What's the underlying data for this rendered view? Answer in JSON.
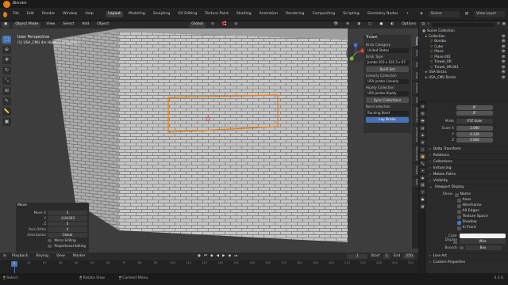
{
  "app": {
    "title": "Blender",
    "menus": [
      "File",
      "Edit",
      "Render",
      "Window",
      "Help"
    ]
  },
  "workspaces": [
    "Layout",
    "Modeling",
    "Sculpting",
    "UV Editing",
    "Texture Paint",
    "Shading",
    "Animation",
    "Rendering",
    "Compositing",
    "Scripting",
    "Geometry Nodes"
  ],
  "active_workspace": "Layout",
  "scene": {
    "scene_label": "Scene",
    "layer_label": "View Layer"
  },
  "viewport_header": {
    "mode": "Object Mode",
    "menus": [
      "View",
      "Select",
      "Add",
      "Object"
    ],
    "transform": "Global",
    "options": "Options"
  },
  "viewport": {
    "view_name": "User Perspective",
    "object_label": "(1) USA_CMU 4in Hipety | Scapreset"
  },
  "tools": [
    "select-tool",
    "cursor-tool",
    "move-tool",
    "rotate-tool",
    "scale-tool",
    "transform-tool",
    "annotate-tool",
    "measure-tool",
    "add-cube-tool"
  ],
  "npanel": {
    "title": "Trowel",
    "brick_category_label": "Brick Category",
    "brick_category": "United States",
    "brick_type_label": "Brick Type",
    "brick_type": "Jumbo 203 x 101.5 x 67",
    "build_btn": "Build Set",
    "lineardy_label": "Linearly Collection",
    "lineardy": "USA Jumbo Linearly",
    "hipety_label": "Hipety Collection",
    "hipety": "USA Jumbo Hipety",
    "sync_btn": "Sync Collections",
    "bond_label": "Bond selection",
    "bond": "Running Bond",
    "lay_btn": "Lay Bricks"
  },
  "vtabs": [
    "Trowel",
    "Item",
    "Tool",
    "View",
    "Create",
    "Edit",
    "BlenderKit",
    "Animation",
    "Sketchfab",
    "Trowel",
    "CAD"
  ],
  "redo_panel": {
    "title": "Move",
    "rows": [
      {
        "label": "Move X",
        "value": "0"
      },
      {
        "label": "Y",
        "value": "-0.84393"
      },
      {
        "label": "Z",
        "value": "0"
      },
      {
        "label": "Axis Ortho",
        "value": "X"
      },
      {
        "label": "Orientation",
        "value": "Global"
      }
    ],
    "checks": [
      "Mirror Editing",
      "Proportional Editing"
    ]
  },
  "outliner": {
    "header": "Scene Collection",
    "rows": [
      {
        "name": "Collection",
        "indent": 0
      },
      {
        "name": "Bombo",
        "indent": 1
      },
      {
        "name": "Cube",
        "indent": 1
      },
      {
        "name": "Plane",
        "indent": 1
      },
      {
        "name": "Plane.001",
        "indent": 1
      },
      {
        "name": "Trowel_OR",
        "indent": 1
      },
      {
        "name": "Trowel_OR.001",
        "indent": 1
      },
      {
        "name": "USA Bricks",
        "indent": 0
      },
      {
        "name": "USA_CMU Bricks",
        "indent": 0
      }
    ]
  },
  "properties": {
    "rot_rows": [
      {
        "label": "",
        "value": "0°"
      },
      {
        "label": "",
        "value": "0°"
      },
      {
        "label": "Mode",
        "value": "XYZ Euler"
      }
    ],
    "scale_rows": [
      {
        "label": "Scale X",
        "value": "2.000"
      },
      {
        "label": "Y",
        "value": "0.128"
      },
      {
        "label": "Z",
        "value": "2.000"
      }
    ],
    "sections": [
      "Delta Transform",
      "Relations",
      "Collections",
      "Instancing",
      "Motion Paths",
      "Visibility",
      "Viewport Display"
    ],
    "vd_show_label": "Show",
    "vd_checks": [
      {
        "label": "Name",
        "on": false
      },
      {
        "label": "Axes",
        "on": false
      },
      {
        "label": "Wireframe",
        "on": false
      },
      {
        "label": "All Edges",
        "on": false
      },
      {
        "label": "Texture Space",
        "on": false
      },
      {
        "label": "Shadow",
        "on": true
      },
      {
        "label": "In Front",
        "on": false
      }
    ],
    "color_label": "Color",
    "display_as_label": "Display As",
    "display_as": "Wire",
    "bounds_label": "Bounds",
    "bounds": "Box",
    "tail_sections": [
      "Line Art",
      "Custom Properties"
    ]
  },
  "timeline": {
    "menus": [
      "Playback",
      "Keying",
      "View",
      "Marker"
    ],
    "frame": "1",
    "start_label": "Start",
    "start": "1",
    "end_label": "End",
    "end": "250",
    "ticks": [
      "0",
      "10",
      "20",
      "30",
      "40",
      "50",
      "60",
      "70",
      "80",
      "90",
      "100",
      "110",
      "120",
      "130",
      "140",
      "150",
      "160",
      "170",
      "180",
      "190",
      "200",
      "210",
      "220",
      "230",
      "240",
      "250"
    ]
  },
  "statusbar": {
    "items": [
      "Select",
      "Rotate View",
      "Context Menu"
    ],
    "version": "3.3.0"
  },
  "colors": {
    "accent": "#4772b3",
    "selection": "#e87d0d",
    "brick": "#c9c9c9",
    "mortar": "#8c8c8c"
  }
}
